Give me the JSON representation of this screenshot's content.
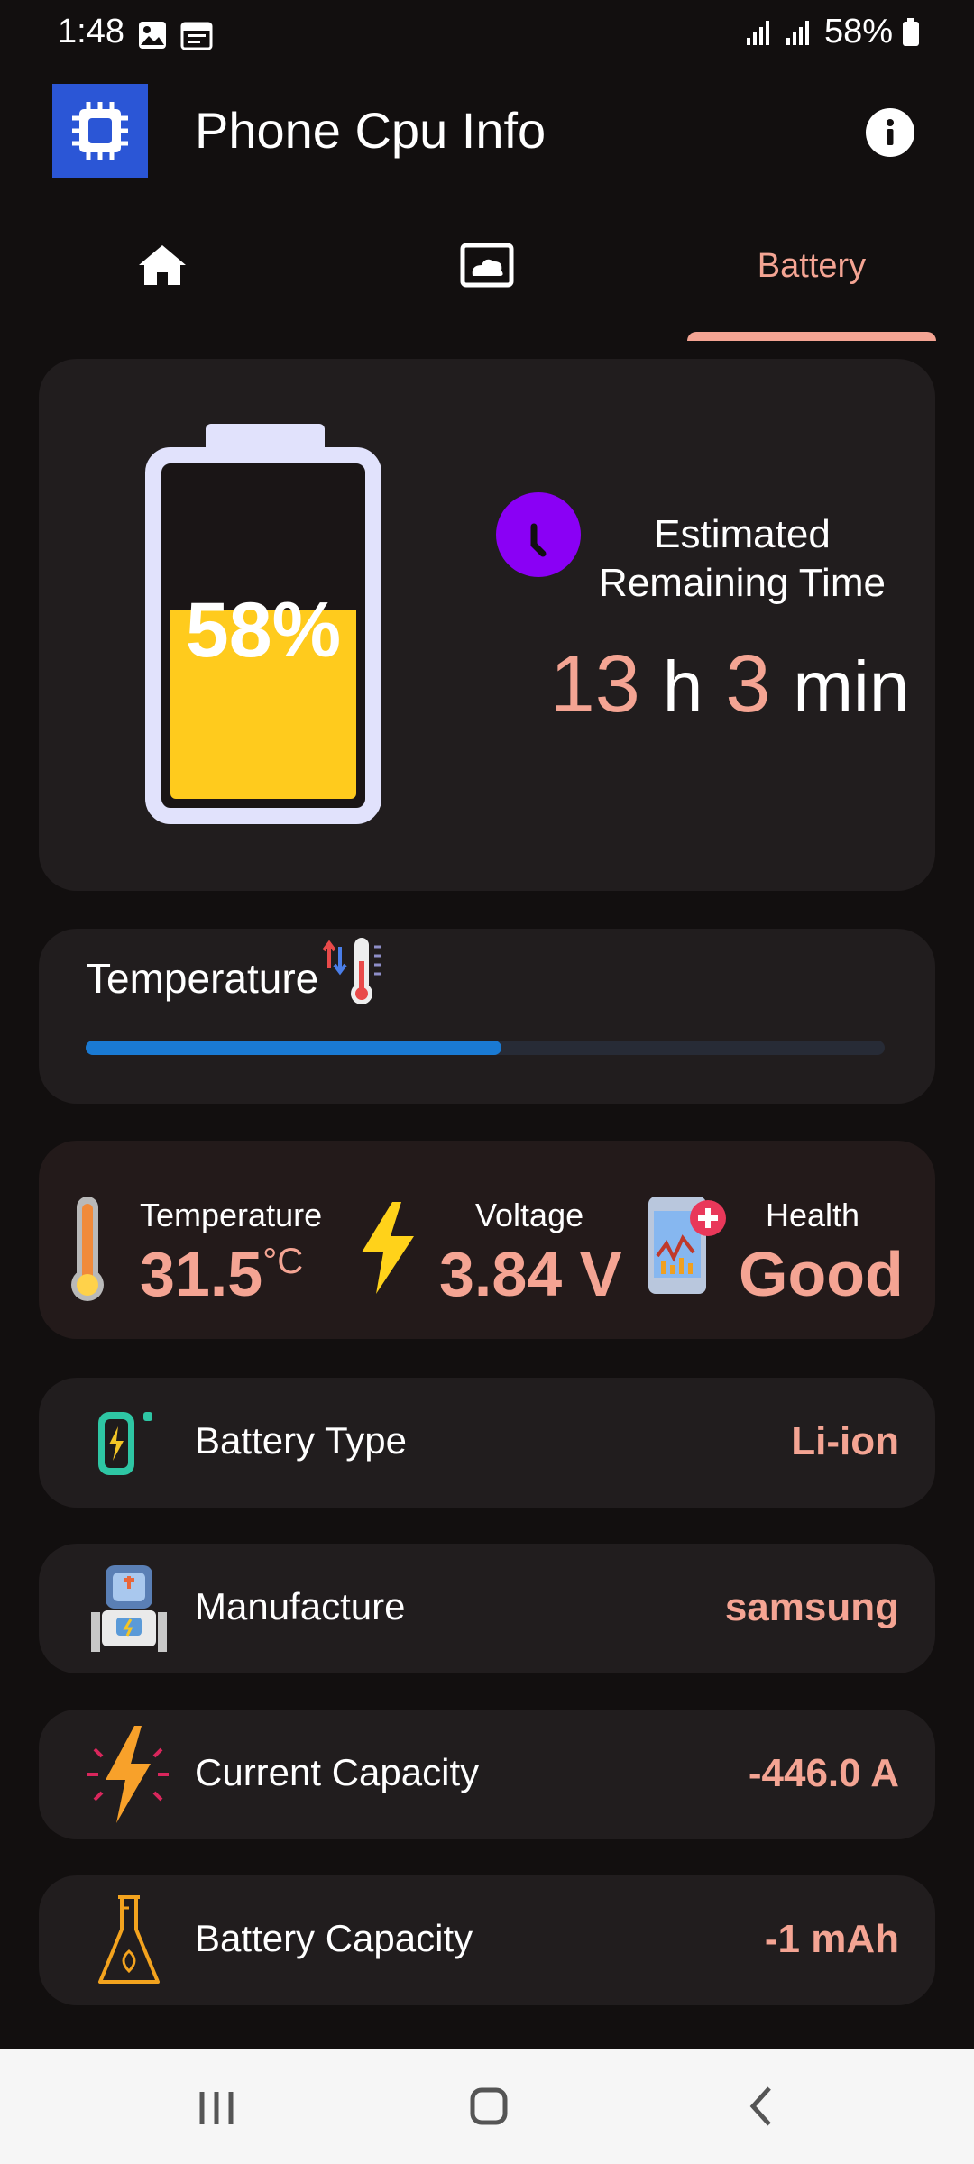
{
  "status_bar": {
    "time": "1:48",
    "battery_text": "58%"
  },
  "app": {
    "title": "Phone Cpu Info"
  },
  "tabs": [
    {
      "name": "home",
      "icon": "home-icon"
    },
    {
      "name": "cloud",
      "icon": "cloud-image-icon"
    },
    {
      "name": "battery",
      "label": "Battery",
      "selected": true
    }
  ],
  "battery": {
    "percent_text": "58%",
    "level_fraction": 0.58,
    "fill_color": "#ffcb1d",
    "eta_label_line1": "Estimated",
    "eta_label_line2": "Remaining Time",
    "hours": "13",
    "hours_unit": "h",
    "minutes": "3",
    "minutes_unit": "min"
  },
  "temperature_bar": {
    "label": "Temperature",
    "level_fraction": 0.52,
    "fill_color": "#1a7ad3"
  },
  "stats": {
    "temperature": {
      "label": "Temperature",
      "value": "31.5",
      "unit": "°C"
    },
    "voltage": {
      "label": "Voltage",
      "value": "3.84 V"
    },
    "health": {
      "label": "Health",
      "value": "Good"
    }
  },
  "rows": [
    {
      "label": "Battery Type",
      "value": "Li-ion",
      "icon": "battery-charging-icon"
    },
    {
      "label": "Manufacture",
      "value": "samsung",
      "icon": "robot-icon"
    },
    {
      "label": "Current Capacity",
      "value": "-446.0 A",
      "icon": "lightning-icon"
    },
    {
      "label": "Battery Capacity",
      "value": "-1 mAh",
      "icon": "flask-icon"
    }
  ],
  "colors": {
    "accent": "#f4a493",
    "background": "#120f0f",
    "card": "#211d1e"
  }
}
